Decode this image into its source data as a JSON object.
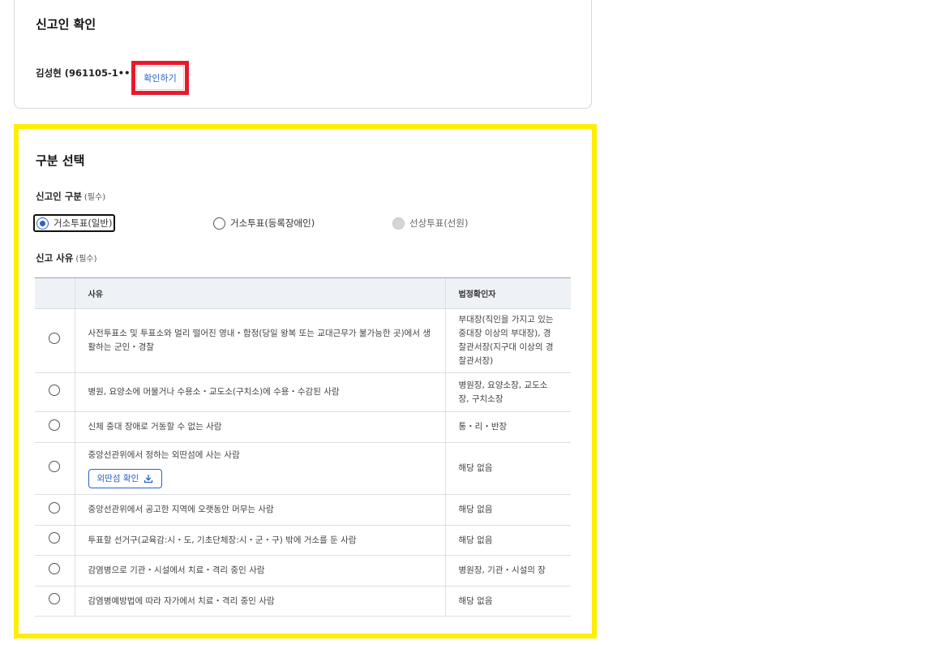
{
  "confirm_card": {
    "title": "신고인 확인",
    "reporter": "김성현 (961105-1••••••)",
    "verify_button": "확인하기"
  },
  "section": {
    "title": "구분 선택",
    "reporter_type_label": "신고인 구분",
    "reporter_type_req": "(필수)",
    "reporter_types": [
      {
        "label": "거소투표(일반)",
        "checked": true
      },
      {
        "label": "거소투표(등록장애인)",
        "checked": false
      },
      {
        "label": "선상투표(선원)",
        "checked": false,
        "disabled": true
      }
    ],
    "reason_label": "신고 사유",
    "reason_req": "(필수)"
  },
  "table": {
    "headers": {
      "reason": "사유",
      "legal": "법정확인자"
    },
    "rows": [
      {
        "reason": "사전투표소 및 투표소와 멀리 떨어진 영내・함정(당일 왕복 또는 교대근무가 불가능한 곳)에서 생활하는 군인・경찰",
        "legal": "부대장(직인을 가지고 있는 중대장 이상의 부대장), 경찰관서장(지구대 이상의 경찰관서장)"
      },
      {
        "reason": "병원, 요양소에 머물거나 수용소・교도소(구치소)에 수용・수감된 사람",
        "legal": "병원장, 요양소장, 교도소장, 구치소장"
      },
      {
        "reason": "신체 중대 장애로 거동할 수 없는 사람",
        "legal": "통・리・반장"
      },
      {
        "reason": "중앙선관위에서 정하는 외딴섬에 사는 사람",
        "legal": "해당 없음",
        "button": "외딴섬 확인"
      },
      {
        "reason": "중앙선관위에서 공고한 지역에 오랫동안 머무는 사람",
        "legal": "해당 없음"
      },
      {
        "reason": "투표할 선거구(교육감:시・도, 기초단체장:시・군・구) 밖에 거소를 둔 사람",
        "legal": "해당 없음"
      },
      {
        "reason": "감염병으로 기관・시설에서 치료・격리 중인 사람",
        "legal": "병원장, 기관・시설의 장"
      },
      {
        "reason": "감염병예방법에 따라 자가에서 치료・격리 중인 사람",
        "legal": "해당 없음"
      }
    ]
  },
  "colors": {
    "accent": "#2962c8",
    "highlight_red": "#e8192c",
    "highlight_yellow": "#ffee00"
  }
}
